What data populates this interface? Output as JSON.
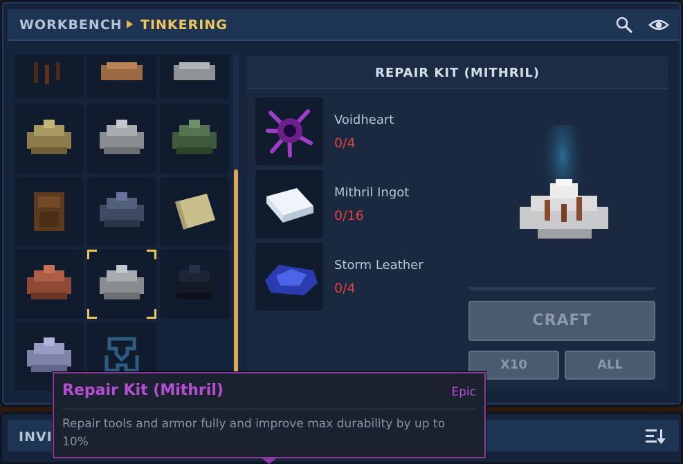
{
  "header": {
    "breadcrumb_root": "WORKBENCH",
    "breadcrumb_current": "TINKERING",
    "icons": [
      "search-icon",
      "eye-icon"
    ]
  },
  "recipe": {
    "title": "REPAIR KIT (MITHRIL)",
    "materials": [
      {
        "name": "Voidheart",
        "count": "0/4",
        "icon": "voidheart-icon"
      },
      {
        "name": "Mithril Ingot",
        "count": "0/16",
        "icon": "mithril-ingot-icon"
      },
      {
        "name": "Storm Leather",
        "count": "0/4",
        "icon": "storm-leather-icon"
      }
    ],
    "craft_label": "CRAFT",
    "x10_label": "X10",
    "all_label": "ALL"
  },
  "inventory": {
    "label": "INVI",
    "sort_icon": "sort-icon"
  },
  "tooltip": {
    "title": "Repair Kit (Mithril)",
    "rarity": "Epic",
    "description": "Repair tools and armor fully and improve max durability by up to 10%"
  },
  "colors": {
    "accent_gold": "#f0c55c",
    "rarity_epic": "#b44fd2",
    "missing_red": "#e0433f"
  }
}
